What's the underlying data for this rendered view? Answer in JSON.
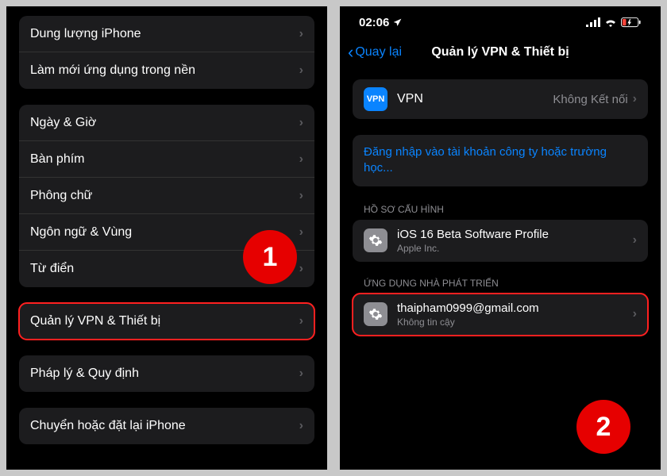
{
  "left": {
    "group1": [
      {
        "label": "Dung lượng iPhone"
      },
      {
        "label": "Làm mới ứng dụng trong nền"
      }
    ],
    "group2": [
      {
        "label": "Ngày & Giờ"
      },
      {
        "label": "Bàn phím"
      },
      {
        "label": "Phông chữ"
      },
      {
        "label": "Ngôn ngữ & Vùng"
      },
      {
        "label": "Từ điển"
      }
    ],
    "group3": [
      {
        "label": "Quản lý VPN & Thiết bị"
      }
    ],
    "group4": [
      {
        "label": "Pháp lý & Quy định"
      }
    ],
    "group5": [
      {
        "label": "Chuyển hoặc đặt lại iPhone"
      }
    ],
    "badge": "1"
  },
  "right": {
    "status": {
      "time": "02:06"
    },
    "nav": {
      "back": "Quay lại",
      "title": "Quản lý VPN & Thiết bị"
    },
    "vpn": {
      "label": "VPN",
      "value": "Không Kết nối",
      "icon_text": "VPN"
    },
    "signin": "Đăng nhập vào tài khoản công ty hoặc trường học...",
    "section_profile": "HỒ SƠ CẤU HÌNH",
    "profile": {
      "title": "iOS 16 Beta Software Profile",
      "subtitle": "Apple Inc."
    },
    "section_dev": "ỨNG DỤNG NHÀ PHÁT TRIỂN",
    "developer": {
      "title": "thaipham0999@gmail.com",
      "subtitle": "Không tin cậy"
    },
    "badge": "2"
  }
}
